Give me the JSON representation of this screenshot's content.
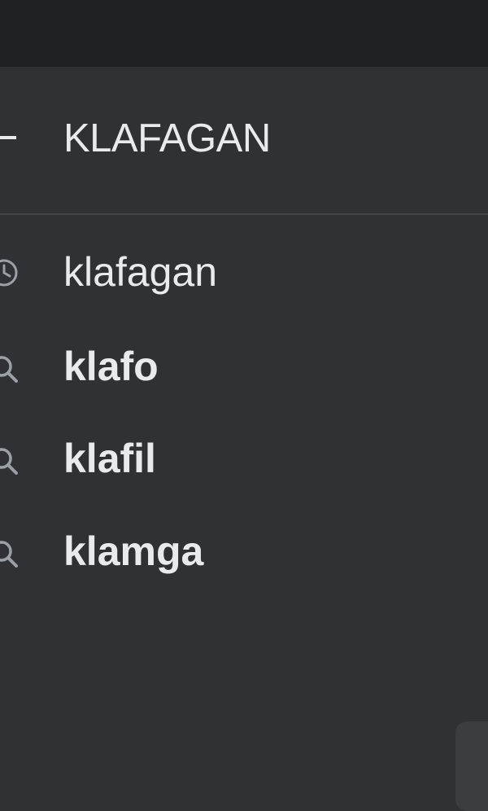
{
  "colors": {
    "top_bar": "#202124",
    "panel": "#303134",
    "text": "#e8eaed",
    "icon": "#9aa0a6",
    "divider": "#44464a"
  },
  "search": {
    "value": "KLAFAGAN",
    "back_icon": "back-arrow-icon"
  },
  "suggestions": [
    {
      "text": "klafagan",
      "icon": "history-clock-icon",
      "kind": "history"
    },
    {
      "text": "klafo",
      "icon": "search-icon",
      "kind": "query"
    },
    {
      "text": "klafil",
      "icon": "search-icon",
      "kind": "query"
    },
    {
      "text": "klamga",
      "icon": "search-icon",
      "kind": "query"
    }
  ]
}
